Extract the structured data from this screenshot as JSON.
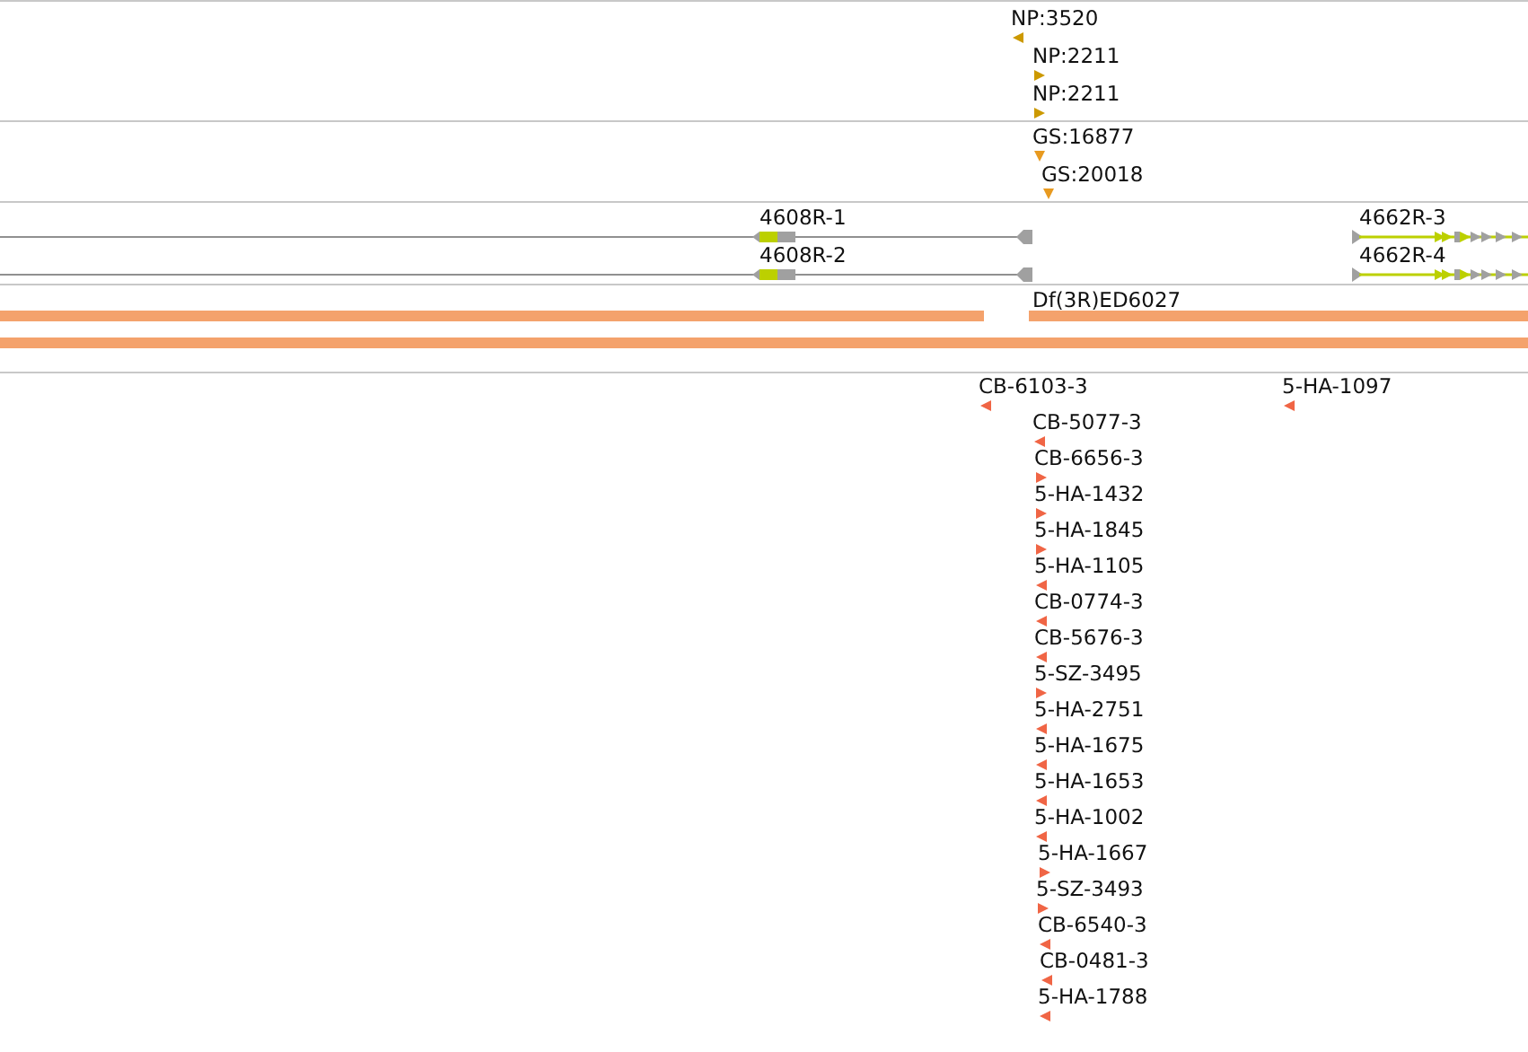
{
  "tracks": [
    {
      "kind": "features",
      "features": [
        {
          "label": "NP:3520",
          "kind": "reverse"
        },
        {
          "label": "NP:2211",
          "kind": "forward"
        },
        {
          "label": "NP:2211",
          "kind": "forward"
        }
      ]
    },
    {
      "kind": "features",
      "features": [
        {
          "label": "GS:16877",
          "kind": "unstranded"
        },
        {
          "label": "GS:20018",
          "kind": "unstranded"
        }
      ]
    },
    {
      "kind": "genes",
      "genes": [
        {
          "label": "4608R-1",
          "kind": "reverse"
        },
        {
          "label": "4608R-2",
          "kind": "reverse"
        },
        {
          "label": "4662R-3",
          "kind": "forward"
        },
        {
          "label": "4662R-4",
          "kind": "forward"
        }
      ]
    },
    {
      "kind": "deficiency",
      "features": [
        {
          "label": "Df(3R)ED6027"
        }
      ]
    },
    {
      "kind": "features",
      "features": [
        {
          "label": "CB-6103-3",
          "kind": "reverse"
        },
        {
          "label": "5-HA-1097",
          "kind": "reverse"
        },
        {
          "label": "CB-5077-3",
          "kind": "reverse"
        },
        {
          "label": "CB-6656-3",
          "kind": "forward"
        },
        {
          "label": "5-HA-1432",
          "kind": "forward"
        },
        {
          "label": "5-HA-1845",
          "kind": "forward"
        },
        {
          "label": "5-HA-1105",
          "kind": "reverse"
        },
        {
          "label": "CB-0774-3",
          "kind": "reverse"
        },
        {
          "label": "CB-5676-3",
          "kind": "reverse"
        },
        {
          "label": "5-SZ-3495",
          "kind": "forward"
        },
        {
          "label": "5-HA-2751",
          "kind": "reverse"
        },
        {
          "label": "5-HA-1675",
          "kind": "reverse"
        },
        {
          "label": "5-HA-1653",
          "kind": "reverse"
        },
        {
          "label": "5-HA-1002",
          "kind": "reverse"
        },
        {
          "label": "5-HA-1667",
          "kind": "forward"
        },
        {
          "label": "5-SZ-3493",
          "kind": "forward"
        },
        {
          "label": "CB-6540-3",
          "kind": "reverse"
        },
        {
          "label": "CB-0481-3",
          "kind": "reverse"
        },
        {
          "label": "5-HA-1788",
          "kind": "reverse"
        }
      ]
    }
  ]
}
